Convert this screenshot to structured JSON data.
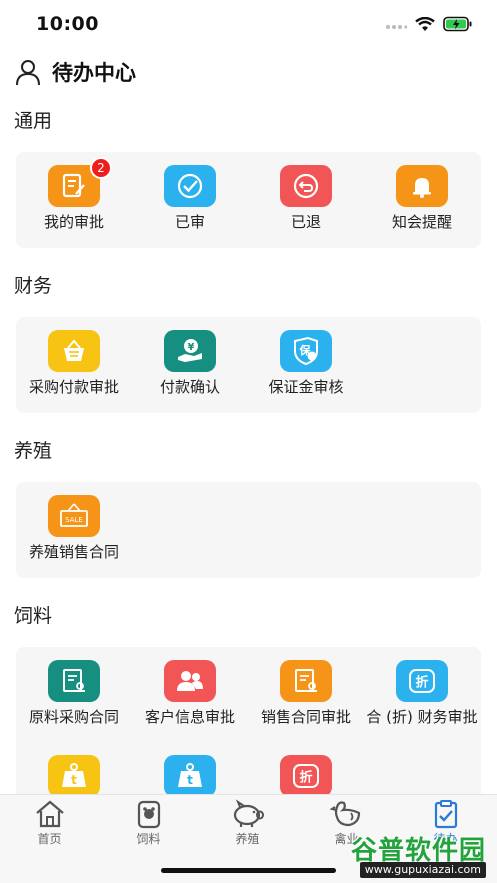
{
  "status_bar": {
    "time": "10:00"
  },
  "header": {
    "title": "待办中心",
    "icon": "user-icon"
  },
  "sections": [
    {
      "title": "通用",
      "items": [
        {
          "label": "我的审批",
          "icon": "approval-form-icon",
          "color": "#f59416",
          "badge": "2"
        },
        {
          "label": "已审",
          "icon": "check-circle-icon",
          "color": "#2ab1ee"
        },
        {
          "label": "已退",
          "icon": "return-icon",
          "color": "#f25555"
        },
        {
          "label": "知会提醒",
          "icon": "bell-icon",
          "color": "#f59416"
        }
      ]
    },
    {
      "title": "财务",
      "items": [
        {
          "label": "采购付款审批",
          "icon": "basket-icon",
          "color": "#f7c414"
        },
        {
          "label": "付款确认",
          "icon": "hand-money-icon",
          "color": "#168f80"
        },
        {
          "label": "保证金审核",
          "icon": "deposit-shield-icon",
          "color": "#2ab1ee",
          "glyph": "保"
        }
      ]
    },
    {
      "title": "养殖",
      "items": [
        {
          "label": "养殖销售合同",
          "icon": "sale-tag-icon",
          "color": "#f59416",
          "glyph": "SALE"
        }
      ]
    },
    {
      "title": "饲料",
      "items": [
        {
          "label": "原料采购合同",
          "icon": "contract-icon",
          "color": "#168f80"
        },
        {
          "label": "客户信息审批",
          "icon": "customers-icon",
          "color": "#f25555"
        },
        {
          "label": "销售合同审批",
          "icon": "contract-icon",
          "color": "#f59416"
        },
        {
          "label": "合 (折) 财务审批",
          "icon": "discount-icon",
          "color": "#2ab1ee",
          "glyph": "折"
        },
        {
          "label": "",
          "icon": "weight-icon",
          "color": "#f7c414",
          "glyph": "t"
        },
        {
          "label": "",
          "icon": "weight-icon",
          "color": "#2ab1ee",
          "glyph": "t"
        },
        {
          "label": "",
          "icon": "discount-icon",
          "color": "#f25555",
          "glyph": "折"
        }
      ]
    }
  ],
  "tab_bar": {
    "tabs": [
      {
        "label": "首页",
        "icon": "home-icon"
      },
      {
        "label": "饲料",
        "icon": "feed-bag-icon"
      },
      {
        "label": "养殖",
        "icon": "pig-icon"
      },
      {
        "label": "禽业",
        "icon": "chicken-icon"
      },
      {
        "label": "待办",
        "icon": "todo-clipboard-icon",
        "active": true
      }
    ]
  },
  "watermark": {
    "title": "谷普软件园",
    "url": "www.gupuxiazai.com"
  }
}
